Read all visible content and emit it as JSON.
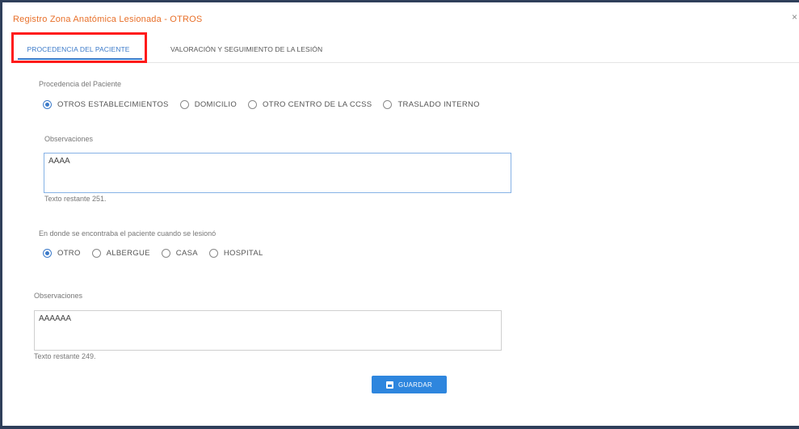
{
  "dialog": {
    "title": "Registro Zona Anatómica Lesionada - OTROS",
    "close_icon": "×"
  },
  "tabs": [
    {
      "label": "PROCEDENCIA DEL PACIENTE",
      "active": true
    },
    {
      "label": "VALORACIÓN Y SEGUIMIENTO DE LA LESIÓN",
      "active": false
    }
  ],
  "procedencia": {
    "label": "Procedencia del Paciente",
    "options": [
      "OTROS ESTABLECIMIENTOS",
      "DOMICILIO",
      "OTRO CENTRO DE LA CCSS",
      "TRASLADO INTERNO"
    ],
    "selected": "OTROS ESTABLECIMIENTOS"
  },
  "observaciones1": {
    "label": "Observaciones",
    "value": "AAAA",
    "remaining": "Texto restante 251."
  },
  "ubicacion": {
    "label": "En donde se encontraba el paciente cuando se lesionó",
    "options": [
      "OTRO",
      "ALBERGUE",
      "CASA",
      "HOSPITAL"
    ],
    "selected": "OTRO"
  },
  "observaciones2": {
    "label": "Observaciones",
    "value": "AAAAAA",
    "remaining": "Texto restante 249."
  },
  "save_button": {
    "label": "GUARDAR",
    "icon": "save-icon"
  },
  "colors": {
    "title": "#e8702a",
    "accent": "#3b7ac9",
    "highlight": "#ff1a1a",
    "button": "#2e86de"
  }
}
